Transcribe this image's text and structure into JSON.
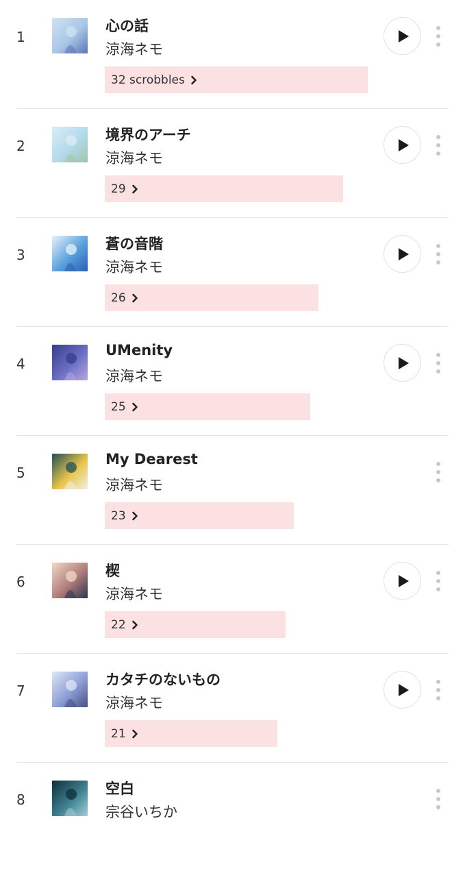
{
  "accent_colors": {
    "bar_fill": "#fce1e2",
    "divider": "#e6e6e6",
    "dots": "#c8c8c8"
  },
  "tracks": [
    {
      "rank": "1",
      "title": "心の話",
      "artist": "涼海ネモ",
      "scrobbles_label": "32 scrobbles",
      "scrobbles": 32,
      "has_play": true,
      "art_colors": [
        "#cfe3f2",
        "#a9c6e6",
        "#5f74b8"
      ]
    },
    {
      "rank": "2",
      "title": "境界のアーチ",
      "artist": "涼海ネモ",
      "scrobbles_label": "29",
      "scrobbles": 29,
      "has_play": true,
      "art_colors": [
        "#d9ecf5",
        "#b4d9ec",
        "#9cc7a2"
      ]
    },
    {
      "rank": "3",
      "title": "蒼の音階",
      "artist": "涼海ネモ",
      "scrobbles_label": "26",
      "scrobbles": 26,
      "has_play": true,
      "art_colors": [
        "#e6f2fa",
        "#5aa0dc",
        "#2b5fb0"
      ]
    },
    {
      "rank": "4",
      "title": "UMenity",
      "artist": "涼海ネモ",
      "scrobbles_label": "25",
      "scrobbles": 25,
      "has_play": true,
      "art_colors": [
        "#3a3c8a",
        "#6a6fc4",
        "#b8a6e0"
      ]
    },
    {
      "rank": "5",
      "title": "My Dearest",
      "artist": "涼海ネモ",
      "scrobbles_label": "23",
      "scrobbles": 23,
      "has_play": false,
      "art_colors": [
        "#1f4f55",
        "#e7c54a",
        "#f1efe4"
      ]
    },
    {
      "rank": "6",
      "title": "楔",
      "artist": "涼海ネモ",
      "scrobbles_label": "22",
      "scrobbles": 22,
      "has_play": true,
      "art_colors": [
        "#f1d9c8",
        "#b07c7a",
        "#2d3550"
      ]
    },
    {
      "rank": "7",
      "title": "カタチのないもの",
      "artist": "涼海ネモ",
      "scrobbles_label": "21",
      "scrobbles": 21,
      "has_play": true,
      "art_colors": [
        "#dfe6f5",
        "#8c9ed6",
        "#4b4f86"
      ]
    },
    {
      "rank": "8",
      "title": "空白",
      "artist": "宗谷いちか",
      "scrobbles_label": "",
      "scrobbles": null,
      "has_play": false,
      "art_colors": [
        "#0f2f3b",
        "#3f7f8f",
        "#9fd0d8"
      ]
    }
  ]
}
